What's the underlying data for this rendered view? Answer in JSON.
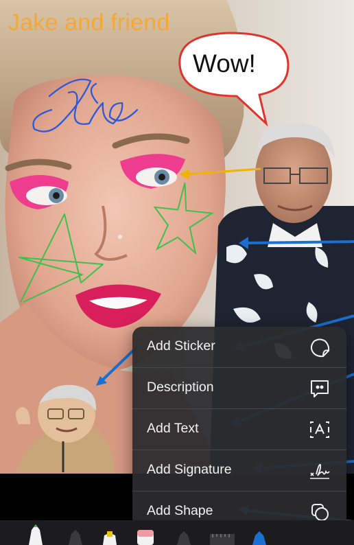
{
  "photo": {
    "caption": "Jake and friend",
    "speech_bubble": "Wow!",
    "signature_scribble": "Jake"
  },
  "menu": {
    "items": [
      {
        "label": "Add Sticker",
        "icon": "sticker-icon"
      },
      {
        "label": "Description",
        "icon": "description-icon"
      },
      {
        "label": "Add Text",
        "icon": "text-box-icon"
      },
      {
        "label": "Add Signature",
        "icon": "signature-icon"
      },
      {
        "label": "Add Shape",
        "icon": "shape-icon"
      }
    ]
  },
  "colors": {
    "caption": "#f4a83a",
    "bubble_outline": "#e0332c",
    "yellow_arrow": "#f2b200",
    "blue_arrows": "#1a6fd1",
    "scribble_blue": "#2d59d6",
    "scribble_green": "#3fbf4c",
    "menu_bg": "#2c2c2e"
  },
  "toolbar": {
    "tools": [
      "pen-tool",
      "pencil-tool",
      "marker-tool",
      "eraser-tool",
      "lasso-tool",
      "ruler-tool",
      "color-tool"
    ]
  }
}
